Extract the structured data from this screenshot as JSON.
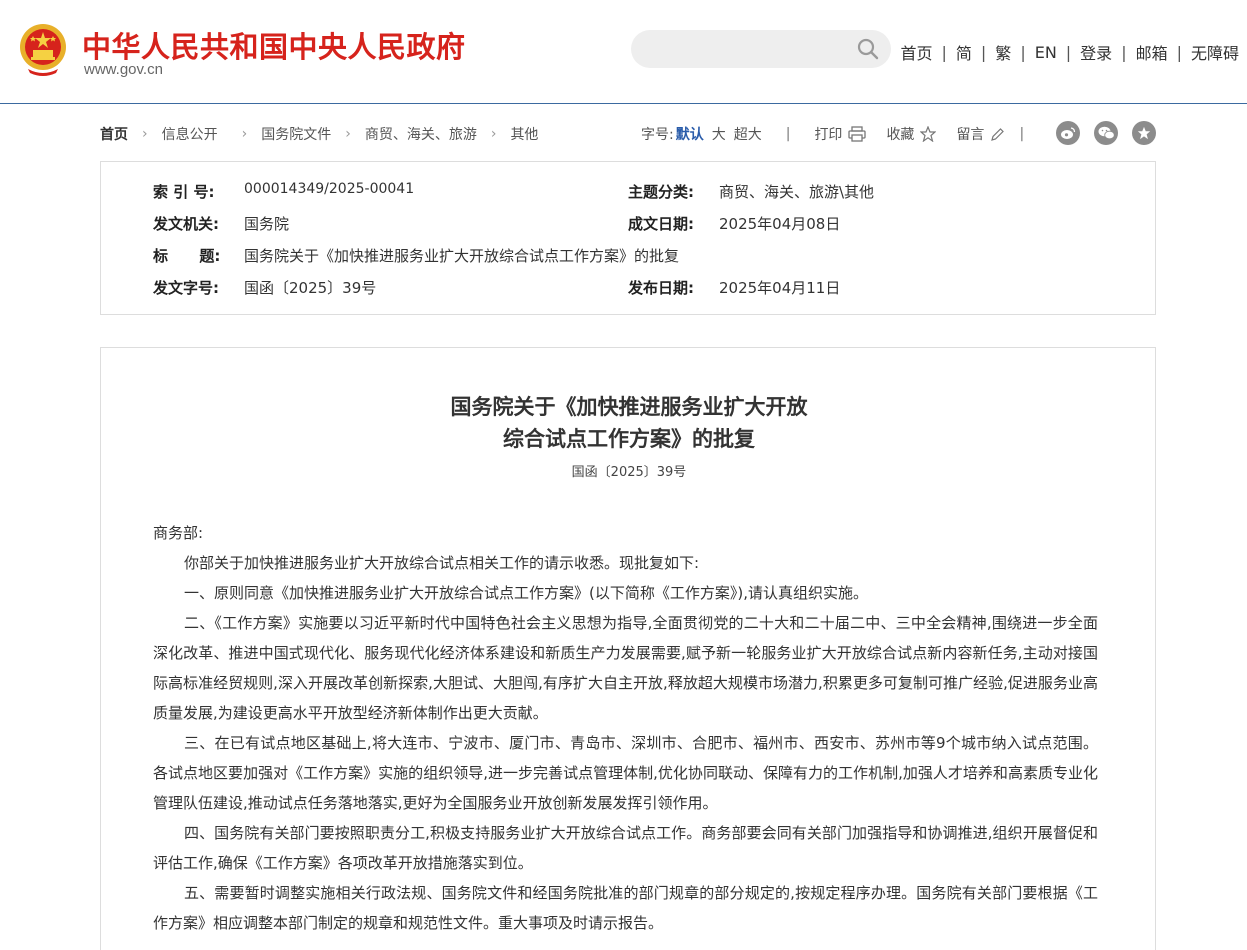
{
  "header": {
    "site_title": "中华人民共和国中央人民政府",
    "site_url": "www.gov.cn",
    "search_placeholder": "",
    "nav": [
      "首页",
      "简",
      "繁",
      "EN",
      "登录",
      "邮箱",
      "无障碍"
    ]
  },
  "breadcrumb": {
    "items": [
      "首页",
      "信息公开",
      "国务院文件",
      "商贸、海关、旅游",
      "其他"
    ]
  },
  "tools": {
    "font_label": "字号:",
    "font_default": "默认",
    "font_large": "大",
    "font_xlarge": "超大",
    "print": "打印",
    "favorite": "收藏",
    "comment": "留言"
  },
  "meta": {
    "index_label": "索 引 号:",
    "index_value": "000014349/2025-00041",
    "subject_label": "主题分类:",
    "subject_value": "商贸、海关、旅游\\其他",
    "issuer_label": "发文机关:",
    "issuer_value": "国务院",
    "written_date_label": "成文日期:",
    "written_date_value": "2025年04月08日",
    "title_label": "标      题:",
    "title_value": "国务院关于《加快推进服务业扩大开放综合试点工作方案》的批复",
    "doc_no_label": "发文字号:",
    "doc_no_value": "国函〔2025〕39号",
    "publish_date_label": "发布日期:",
    "publish_date_value": "2025年04月11日"
  },
  "article": {
    "title_line1": "国务院关于《加快推进服务业扩大开放",
    "title_line2": "综合试点工作方案》的批复",
    "doc_no": "国函〔2025〕39号",
    "salutation": "商务部:",
    "p0": "你部关于加快推进服务业扩大开放综合试点相关工作的请示收悉。现批复如下:",
    "p1": "一、原则同意《加快推进服务业扩大开放综合试点工作方案》(以下简称《工作方案》),请认真组织实施。",
    "p2": "二、《工作方案》实施要以习近平新时代中国特色社会主义思想为指导,全面贯彻党的二十大和二十届二中、三中全会精神,围绕进一步全面深化改革、推进中国式现代化、服务现代化经济体系建设和新质生产力发展需要,赋予新一轮服务业扩大开放综合试点新内容新任务,主动对接国际高标准经贸规则,深入开展改革创新探索,大胆试、大胆闯,有序扩大自主开放,释放超大规模市场潜力,积累更多可复制可推广经验,促进服务业高质量发展,为建设更高水平开放型经济新体制作出更大贡献。",
    "p3": "三、在已有试点地区基础上,将大连市、宁波市、厦门市、青岛市、深圳市、合肥市、福州市、西安市、苏州市等9个城市纳入试点范围。各试点地区要加强对《工作方案》实施的组织领导,进一步完善试点管理体制,优化协同联动、保障有力的工作机制,加强人才培养和高素质专业化管理队伍建设,推动试点任务落地落实,更好为全国服务业开放创新发展发挥引领作用。",
    "p4": "四、国务院有关部门要按照职责分工,积极支持服务业扩大开放综合试点工作。商务部要会同有关部门加强指导和协调推进,组织开展督促和评估工作,确保《工作方案》各项改革开放措施落实到位。",
    "p5": "五、需要暂时调整实施相关行政法规、国务院文件和经国务院批准的部门规章的部分规定的,按规定程序办理。国务院有关部门要根据《工作方案》相应调整本部门制定的规章和规范性文件。重大事项及时请示报告。"
  },
  "colors": {
    "brand_red": "#d6231c",
    "link_blue": "#2a5caa",
    "header_rule": "#3b6aa0"
  }
}
